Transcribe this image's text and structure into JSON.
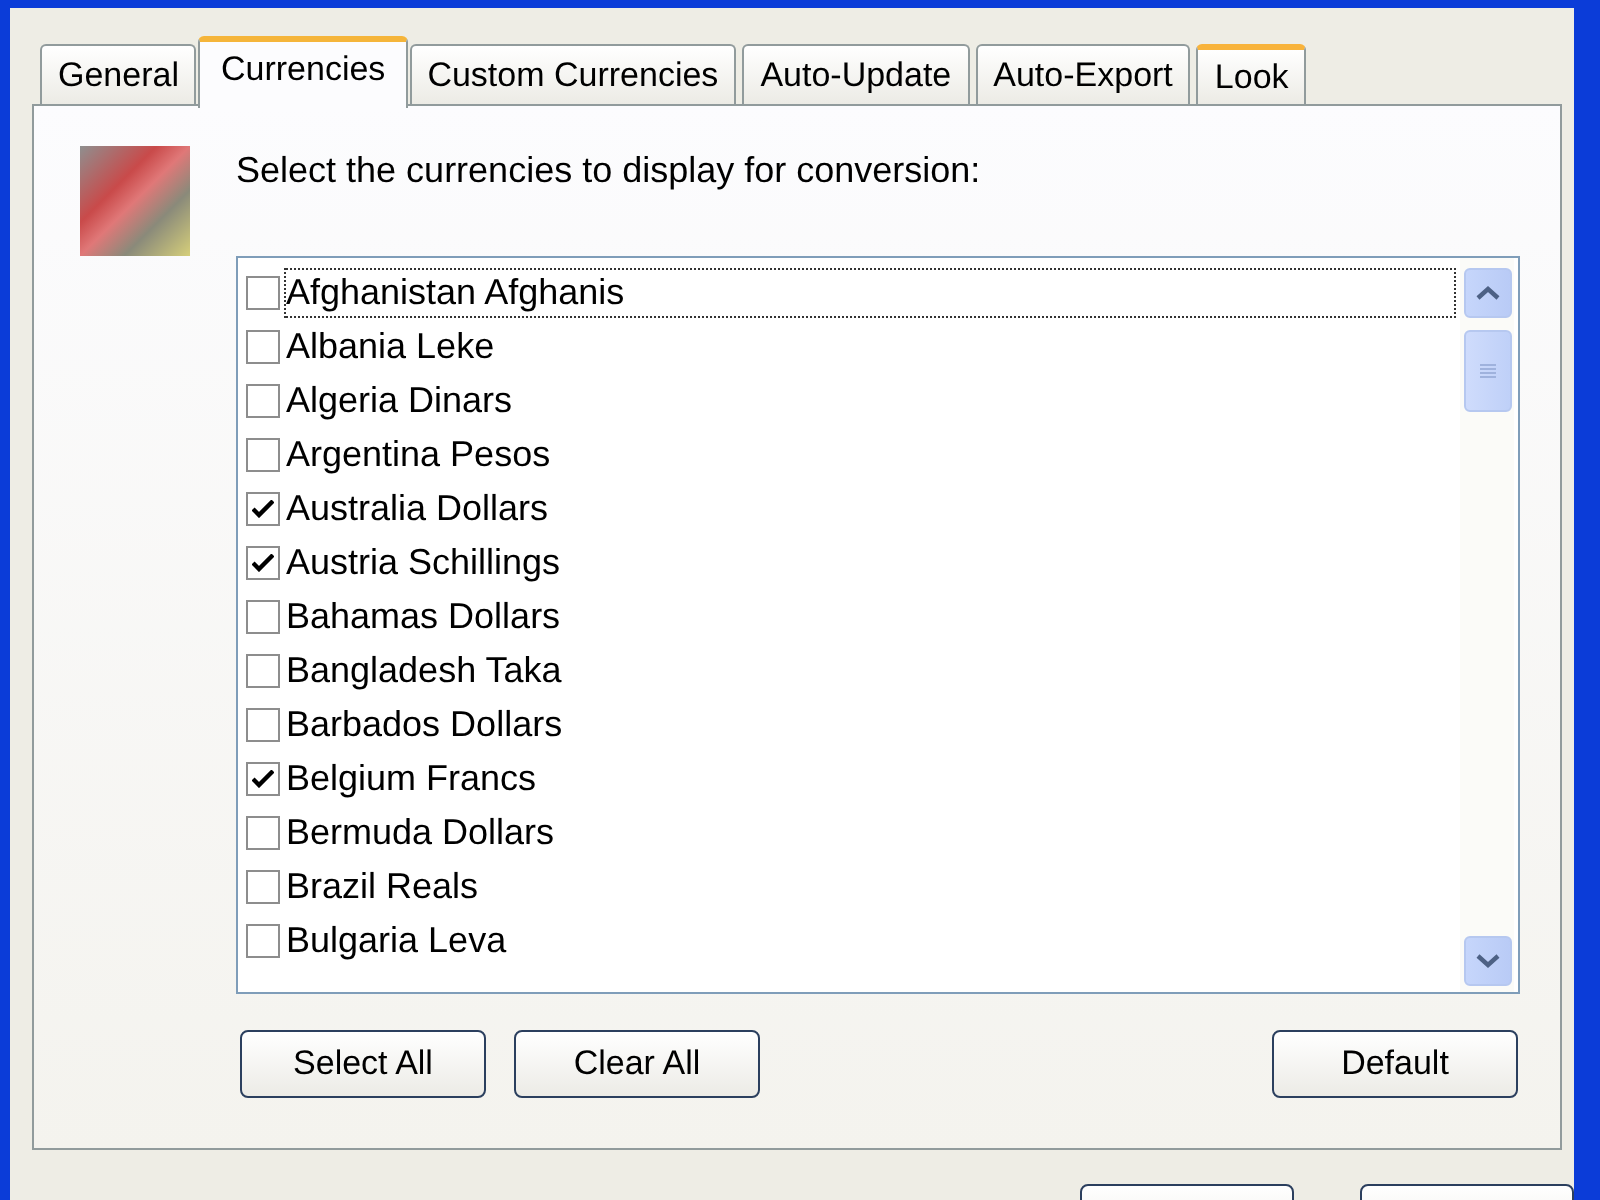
{
  "tabs": [
    {
      "label": "General",
      "selected": false,
      "hovered": false
    },
    {
      "label": "Currencies",
      "selected": true,
      "hovered": false
    },
    {
      "label": "Custom Currencies",
      "selected": false,
      "hovered": false
    },
    {
      "label": "Auto-Update",
      "selected": false,
      "hovered": false
    },
    {
      "label": "Auto-Export",
      "selected": false,
      "hovered": false
    },
    {
      "label": "Look",
      "selected": false,
      "hovered": true
    }
  ],
  "instruction": "Select the currencies to display for conversion:",
  "currency_list": {
    "items": [
      {
        "label": "Afghanistan Afghanis",
        "checked": false,
        "focused": true
      },
      {
        "label": "Albania Leke",
        "checked": false,
        "focused": false
      },
      {
        "label": "Algeria Dinars",
        "checked": false,
        "focused": false
      },
      {
        "label": "Argentina Pesos",
        "checked": false,
        "focused": false
      },
      {
        "label": "Australia Dollars",
        "checked": true,
        "focused": false
      },
      {
        "label": "Austria Schillings",
        "checked": true,
        "focused": false
      },
      {
        "label": "Bahamas Dollars",
        "checked": false,
        "focused": false
      },
      {
        "label": "Bangladesh Taka",
        "checked": false,
        "focused": false
      },
      {
        "label": "Barbados Dollars",
        "checked": false,
        "focused": false
      },
      {
        "label": "Belgium Francs",
        "checked": true,
        "focused": false
      },
      {
        "label": "Bermuda Dollars",
        "checked": false,
        "focused": false
      },
      {
        "label": "Brazil Reals",
        "checked": false,
        "focused": false
      },
      {
        "label": "Bulgaria Leva",
        "checked": false,
        "focused": false
      }
    ]
  },
  "left_buttons": [
    "Select All",
    "Clear All"
  ],
  "right_buttons": [
    "Default"
  ]
}
